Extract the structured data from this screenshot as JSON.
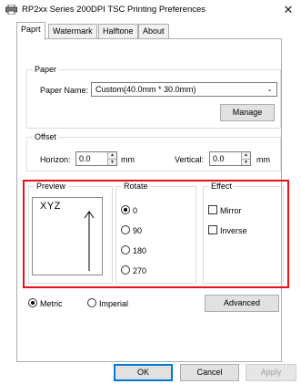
{
  "window": {
    "title": "RP2xx Series 200DPI TSC Printing Preferences",
    "close": "✕"
  },
  "tabs": [
    {
      "label": "Paprt"
    },
    {
      "label": "Watermark"
    },
    {
      "label": "Halftone"
    },
    {
      "label": "About"
    }
  ],
  "paper": {
    "legend": "Paper",
    "name_label": "Paper Name:",
    "name_value": "Custom(40.0mm * 30.0mm)",
    "manage_label": "Manage"
  },
  "offset": {
    "legend": "Offset",
    "horizon_label": "Horizon:",
    "horizon_value": "0.0",
    "horizon_unit": "mm",
    "vertical_label": "Vertical:",
    "vertical_value": "0.0",
    "vertical_unit": "mm"
  },
  "preview": {
    "legend": "Preview",
    "sample_text": "XYZ"
  },
  "rotate": {
    "legend": "Rotate",
    "options": [
      "0",
      "90",
      "180",
      "270"
    ],
    "selected": "0"
  },
  "effect": {
    "legend": "Effect",
    "mirror_label": "Mirror",
    "inverse_label": "Inverse"
  },
  "units": {
    "metric_label": "Metric",
    "imperial_label": "Imperial",
    "selected": "Metric"
  },
  "advanced_label": "Advanced",
  "footer": {
    "ok_label": "OK",
    "cancel_label": "Cancel",
    "apply_label": "Apply"
  },
  "colors": {
    "highlight": "#e8101a",
    "focus": "#0078d7"
  },
  "icons": {
    "title": "printer-icon",
    "close": "close-icon"
  }
}
